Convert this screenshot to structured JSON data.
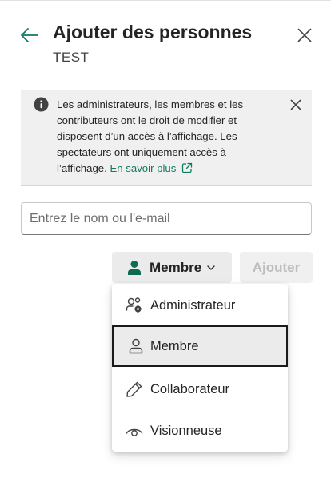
{
  "dialog": {
    "title": "Ajouter des personnes",
    "subtitle": "TEST"
  },
  "banner": {
    "text": "Les administrateurs, les membres et les contributeurs ont le droit de modifier et disposent d’un accès à l’affichage. Les spectateurs ont uniquement accès à l’affichage.",
    "link_label": "En savoir plus"
  },
  "search": {
    "value": "",
    "placeholder": "Entrez le nom ou l'e-mail"
  },
  "role_selector": {
    "selected_label": "Membre"
  },
  "add_button": {
    "label": "Ajouter",
    "enabled": false
  },
  "role_menu": {
    "items": [
      {
        "label": "Administrateur",
        "icon": "people-settings-icon"
      },
      {
        "label": "Membre",
        "icon": "person-icon",
        "selected": true
      },
      {
        "label": "Collaborateur",
        "icon": "pencil-icon"
      },
      {
        "label": "Visionneuse",
        "icon": "eye-icon"
      }
    ]
  },
  "colors": {
    "accent": "#0f7b5f",
    "banner_bg": "#f0f0f0",
    "button_bg": "#ebebeb",
    "disabled_text": "#bdbdbd"
  }
}
